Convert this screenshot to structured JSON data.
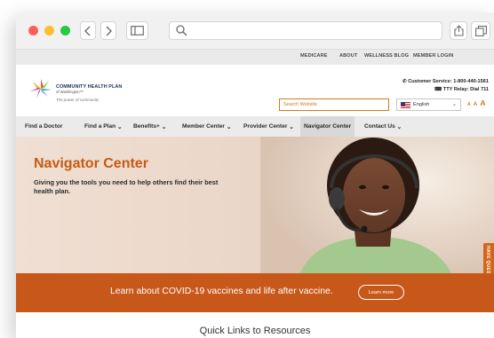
{
  "browser": {
    "back_icon": "chevron-left-icon",
    "forward_icon": "chevron-right-icon",
    "sidebar_icon": "sidebar-icon",
    "search_icon": "magnifier-icon",
    "share_icon": "share-icon",
    "tabs_icon": "tabs-icon"
  },
  "utility_nav": [
    "MEDICARE",
    "ABOUT",
    "WELLNESS BLOG",
    "MEMBER LOGIN"
  ],
  "logo": {
    "name": "COMMUNITY HEALTH PLAN",
    "sub": "of Washington™",
    "tagline": "The power of community"
  },
  "contact": {
    "customer_service": "Customer Service: 1-800-440-1561",
    "tty": "TTY Relay: Dial 711"
  },
  "search": {
    "placeholder": "Search Website"
  },
  "language": {
    "selected": "English"
  },
  "text_size": [
    "A",
    "A",
    "A"
  ],
  "main_nav": [
    {
      "label": "Find a Doctor",
      "dropdown": false
    },
    {
      "label": "Find a Plan",
      "dropdown": true
    },
    {
      "label": "Benefits+",
      "dropdown": true
    },
    {
      "label": "Member Center",
      "dropdown": true
    },
    {
      "label": "Provider Center",
      "dropdown": true
    },
    {
      "label": "Navigator Center",
      "dropdown": false,
      "active": true
    },
    {
      "label": "Contact Us",
      "dropdown": true
    }
  ],
  "hero": {
    "title": "Navigator Center",
    "subtitle": "Giving you the tools you need to help others find their best health plan."
  },
  "side_tab": "HAVE QUESTIONS?",
  "banner": {
    "text": "Learn about COVID-19 vaccines and life after vaccine.",
    "button": "Learn more"
  },
  "quick_links": {
    "title": "Quick Links to Resources"
  },
  "colors": {
    "accent": "#c8581a",
    "title_orange": "#c75b12",
    "nav_bg": "#ebebeb"
  }
}
